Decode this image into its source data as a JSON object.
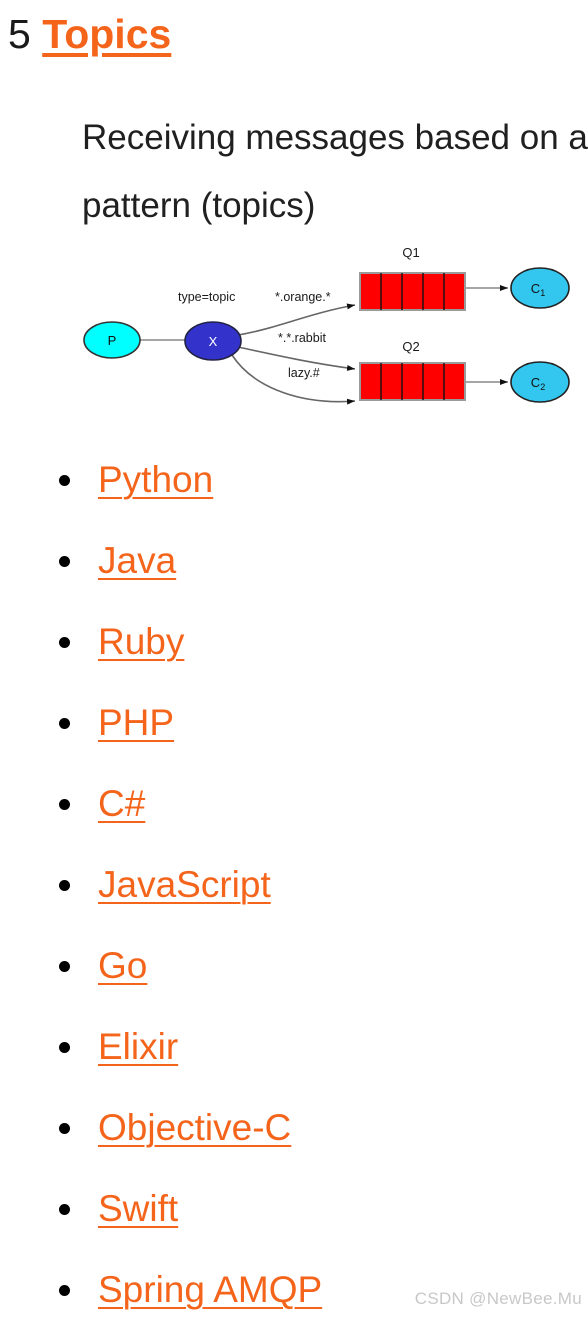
{
  "heading": {
    "number": "5",
    "link_label": "Topics",
    "link_color": "#f4641b"
  },
  "subtitle": {
    "text": "Receiving messages based on a pattern (topics)"
  },
  "diagram": {
    "alt": "RabbitMQ topic exchange routing diagram",
    "producer": {
      "label": "P",
      "fill": "#00ffff"
    },
    "exchange": {
      "label": "X",
      "fill": "#3333cc",
      "type_label": "type=topic"
    },
    "bindings": [
      {
        "key": "*.orange.*",
        "to": "Q1"
      },
      {
        "key": "*.*.rabbit",
        "to": "Q2"
      },
      {
        "key": "lazy.#",
        "to": "Q2"
      }
    ],
    "queues": [
      {
        "label": "Q1",
        "fill": "#ff0000",
        "cells": 5
      },
      {
        "label": "Q2",
        "fill": "#ff0000",
        "cells": 5
      }
    ],
    "consumers": [
      {
        "label": "C",
        "sub": "1",
        "fill": "#33c6ee"
      },
      {
        "label": "C",
        "sub": "2",
        "fill": "#33c6ee"
      }
    ]
  },
  "topic_list": {
    "items": [
      {
        "label": "Python"
      },
      {
        "label": "Java"
      },
      {
        "label": "Ruby"
      },
      {
        "label": "PHP"
      },
      {
        "label": "C#"
      },
      {
        "label": "JavaScript"
      },
      {
        "label": "Go"
      },
      {
        "label": "Elixir"
      },
      {
        "label": "Objective-C"
      },
      {
        "label": "Swift"
      },
      {
        "label": "Spring AMQP"
      }
    ]
  },
  "watermark": {
    "text": "CSDN @NewBee.Mu"
  }
}
